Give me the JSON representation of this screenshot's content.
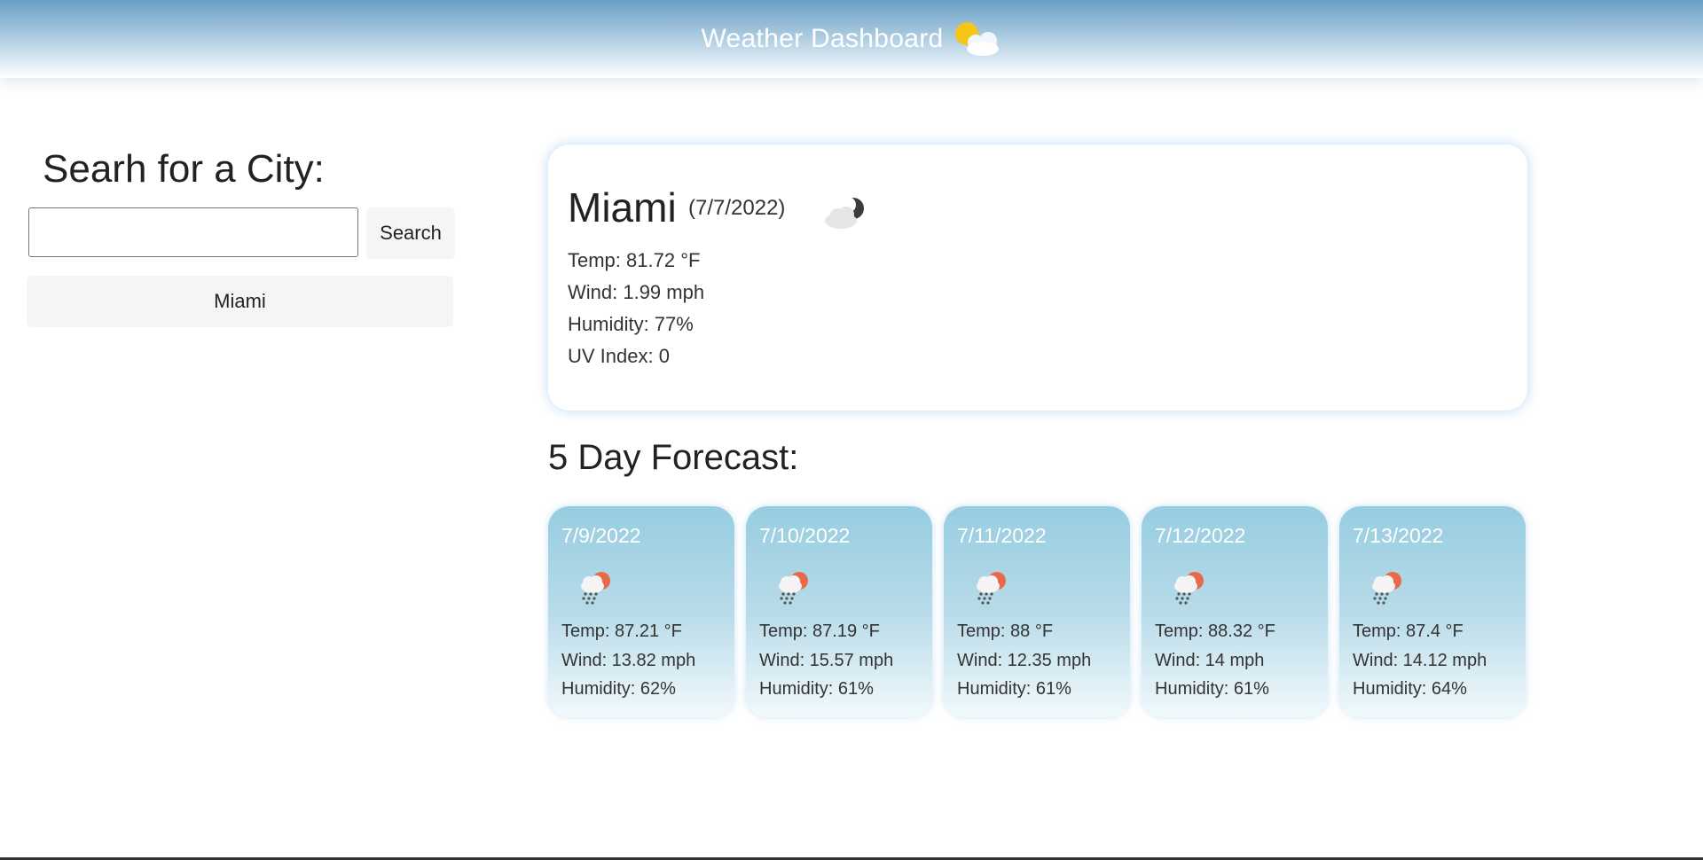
{
  "header": {
    "title": "Weather Dashboard",
    "icon": "sun-behind-cloud-icon"
  },
  "sidebar": {
    "heading": "Searh for a City:",
    "search_value": "",
    "search_placeholder": "",
    "search_button": "Search",
    "history": [
      "Miami"
    ]
  },
  "current": {
    "city": "Miami",
    "date": "(7/7/2022)",
    "icon": "cloud-moon-icon",
    "temp": "Temp: 81.72 °F",
    "wind": "Wind: 1.99 mph",
    "humidity": "Humidity: 77%",
    "uv": "UV Index: 0"
  },
  "forecast": {
    "heading": "5 Day Forecast:",
    "days": [
      {
        "date": "7/9/2022",
        "icon": "rain-sun-icon",
        "temp": "Temp: 87.21 °F",
        "wind": "Wind: 13.82 mph",
        "humidity": "Humidity: 62%"
      },
      {
        "date": "7/10/2022",
        "icon": "rain-sun-icon",
        "temp": "Temp: 87.19 °F",
        "wind": "Wind: 15.57 mph",
        "humidity": "Humidity: 61%"
      },
      {
        "date": "7/11/2022",
        "icon": "rain-sun-icon",
        "temp": "Temp: 88 °F",
        "wind": "Wind: 12.35 mph",
        "humidity": "Humidity: 61%"
      },
      {
        "date": "7/12/2022",
        "icon": "rain-sun-icon",
        "temp": "Temp: 88.32 °F",
        "wind": "Wind: 14 mph",
        "humidity": "Humidity: 61%"
      },
      {
        "date": "7/13/2022",
        "icon": "rain-sun-icon",
        "temp": "Temp: 87.4 °F",
        "wind": "Wind: 14.12 mph",
        "humidity": "Humidity: 64%"
      }
    ]
  },
  "colors": {
    "header_top": "#6b9fc5",
    "card_top": "#96cde0",
    "card_glow": "#96c8f0"
  }
}
